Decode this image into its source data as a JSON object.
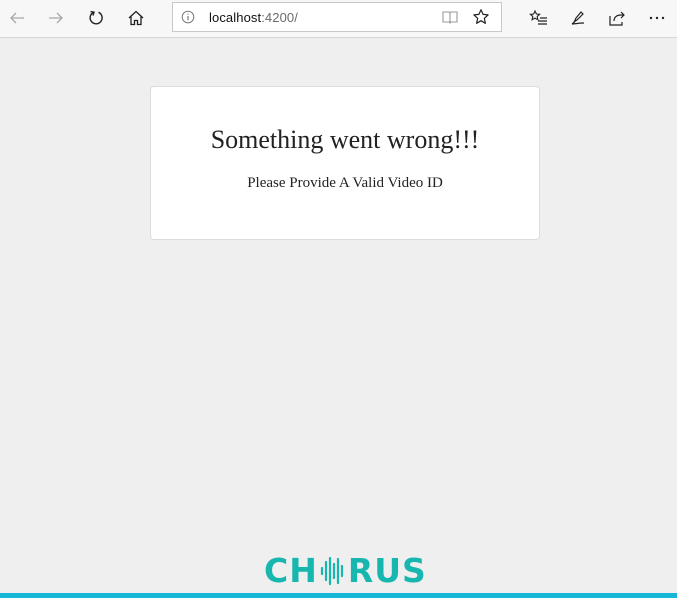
{
  "browser": {
    "url_host": "localhost",
    "url_port": ":4200/"
  },
  "error": {
    "title": "Something went wrong!!!",
    "message": "Please Provide A Valid Video ID"
  },
  "logo": {
    "left_text": "CH",
    "right_text": "RUS"
  },
  "colors": {
    "brand": "#17b7b0",
    "bottom_bar": "#16b6d6",
    "background": "#efefef"
  }
}
